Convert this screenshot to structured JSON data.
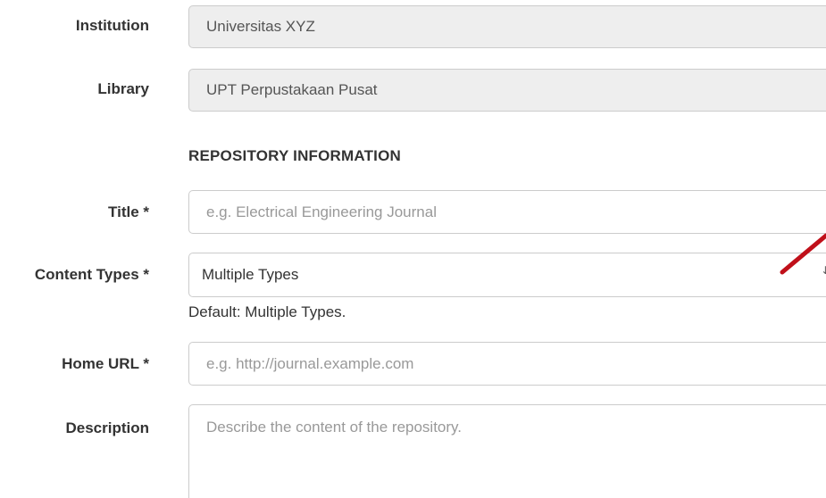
{
  "form": {
    "institution": {
      "label": "Institution",
      "value": "Universitas XYZ"
    },
    "library": {
      "label": "Library",
      "value": "UPT Perpustakaan Pusat"
    },
    "section_heading": "REPOSITORY INFORMATION",
    "title": {
      "label": "Title *",
      "placeholder": "e.g. Electrical Engineering Journal"
    },
    "content_types": {
      "label": "Content Types *",
      "selected": "Multiple Types",
      "help": "Default: Multiple Types."
    },
    "home_url": {
      "label": "Home URL *",
      "placeholder": "e.g. http://journal.example.com"
    },
    "description": {
      "label": "Description",
      "placeholder": "Describe the content of the repository."
    }
  },
  "annotation": {
    "arrow_color": "#c0101a"
  },
  "colors": {
    "readonly_bg": "#eeeeee",
    "border": "#cccccc",
    "placeholder": "#999999",
    "text": "#333333"
  }
}
